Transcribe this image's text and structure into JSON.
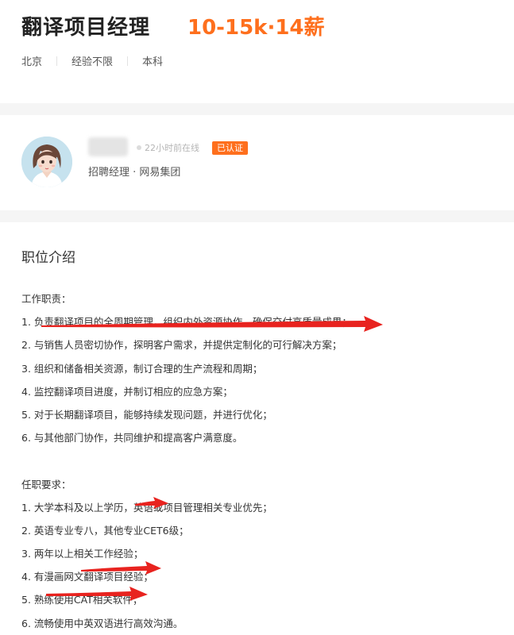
{
  "job": {
    "title": "翻译项目经理",
    "salary": "10-15k·14薪",
    "tags": [
      "北京",
      "经验不限",
      "本科"
    ]
  },
  "recruiter": {
    "online_status": "22小时前在线",
    "verified_badge": "已认证",
    "title": "招聘经理 · 网易集团"
  },
  "description": {
    "heading": "职位介绍",
    "responsibilities_heading": "工作职责：",
    "responsibilities": [
      "1. 负责翻译项目的全周期管理，组织内外资源协作，确保交付高质量成果；",
      "2. 与销售人员密切协作，探明客户需求，并提供定制化的可行解决方案；",
      "3. 组织和储备相关资源，制订合理的生产流程和周期；",
      "4. 监控翻译项目进度，并制订相应的应急方案；",
      "5. 对于长期翻译项目，能够持续发现问题，并进行优化；",
      "6. 与其他部门协作，共同维护和提高客户满意度。"
    ],
    "requirements_heading": "任职要求：",
    "requirements": [
      "1. 大学本科及以上学历，英语或项目管理相关专业优先；",
      "2. 英语专业专八，其他专业CET6级；",
      "3. 两年以上相关工作经验；",
      "4. 有漫画网文翻译项目经验；",
      "5. 熟练使用CAT相关软件；",
      "6. 流畅使用中英双语进行高效沟通。"
    ]
  },
  "colors": {
    "accent": "#fe6f1d",
    "annotation": "#e8231f",
    "divider_band": "#f5f5f5"
  },
  "icons": {
    "avatar": "recruiter-avatar-illustration",
    "online": "online-status-dot-icon"
  }
}
